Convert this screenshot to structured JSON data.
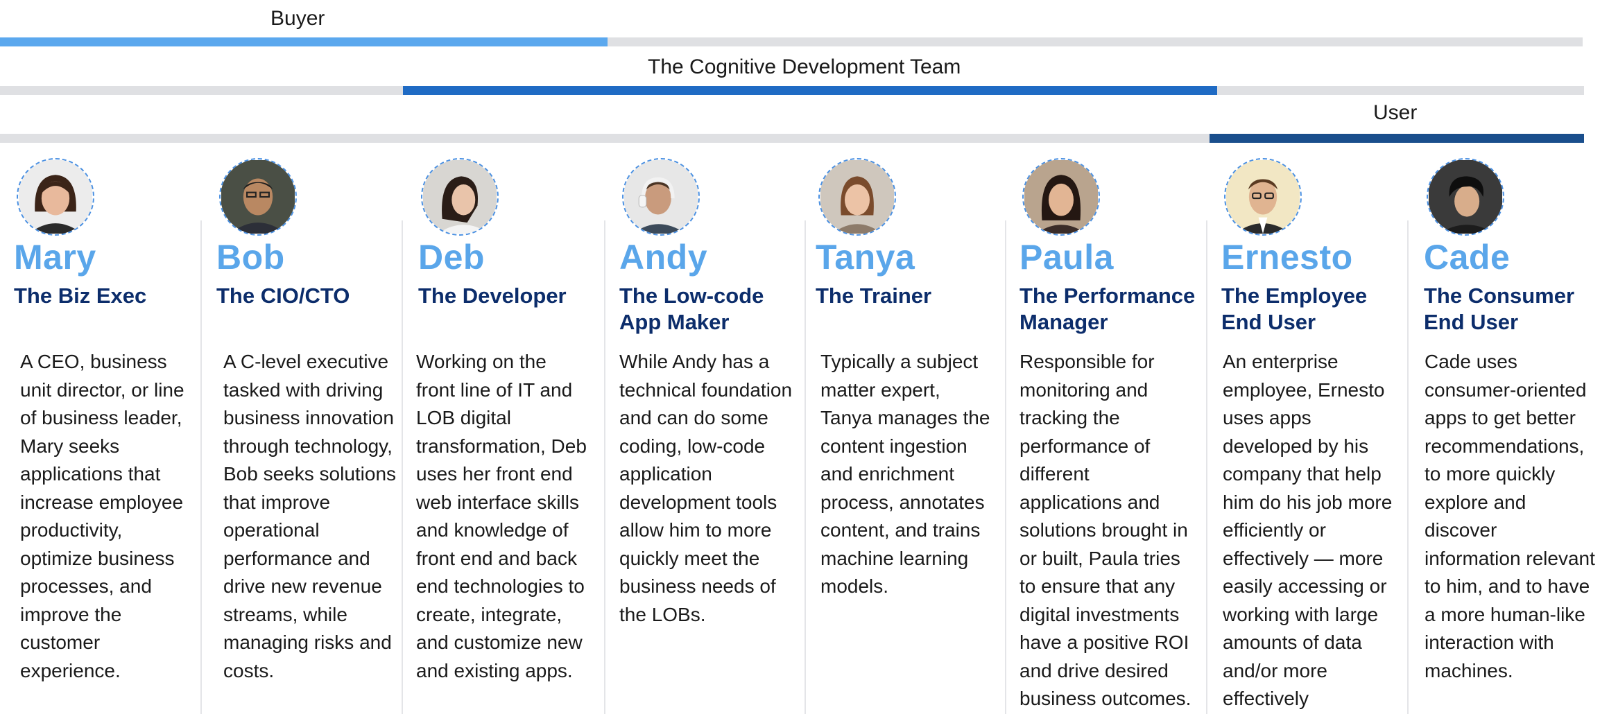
{
  "colors": {
    "buyer": "#5ba8ee",
    "team": "#1f6bc4",
    "user": "#1a4e8c",
    "track": "#dfe0e3",
    "name": "#5aa6ea",
    "role": "#0c2d6b"
  },
  "bands": {
    "buyer": {
      "label": "Buyer"
    },
    "team": {
      "label": "The Cognitive Development Team"
    },
    "user": {
      "label": "User"
    }
  },
  "personas": [
    {
      "name": "Mary",
      "role": "The Biz Exec",
      "description": "A CEO, business unit director, or line of business leader, Mary seeks applications that increase employee productivity, optimize business processes, and improve the customer experience.",
      "avatar": "mary-avatar"
    },
    {
      "name": "Bob",
      "role": "The CIO/CTO",
      "description": "A C-level executive tasked with driving business innovation through technology, Bob seeks solutions that improve operational performance and drive new revenue streams, while managing risks and costs.",
      "avatar": "bob-avatar"
    },
    {
      "name": "Deb",
      "role": "The Developer",
      "description": "Working on the front line of IT and LOB digital transformation, Deb uses her front end web interface skills and knowledge of front end and back end technologies to create, integrate, and customize new and existing apps.",
      "avatar": "deb-avatar"
    },
    {
      "name": "Andy",
      "role": "The Low-code\nApp Maker",
      "description": "While Andy has a technical foundation and can do some coding, low-code application development tools allow him to more quickly meet the business needs of the LOBs.",
      "avatar": "andy-avatar"
    },
    {
      "name": "Tanya",
      "role": "The Trainer",
      "description": "Typically a subject matter expert, Tanya manages the content ingestion and enrichment process, annotates content, and trains machine learning models.",
      "avatar": "tanya-avatar"
    },
    {
      "name": "Paula",
      "role": "The Performance\nManager",
      "description": "Responsible for monitoring and tracking the performance of different applications and solutions brought in or built, Paula tries to ensure that any digital investments have a positive ROI and drive desired business outcomes.",
      "avatar": "paula-avatar"
    },
    {
      "name": "Ernesto",
      "role": "The Employee\nEnd User",
      "description": "An enterprise employee, Ernesto uses apps developed by his company that help him do his job more efficiently or effectively — more easily accessing or working with large amounts of data and/or more effectively",
      "avatar": "ernesto-avatar"
    },
    {
      "name": "Cade",
      "role": "The Consumer\nEnd User",
      "description": "Cade uses consumer-oriented apps to get better recommendations, to more quickly explore and discover information relevant to him, and to have a more human-like interaction with machines.",
      "avatar": "cade-avatar"
    }
  ]
}
